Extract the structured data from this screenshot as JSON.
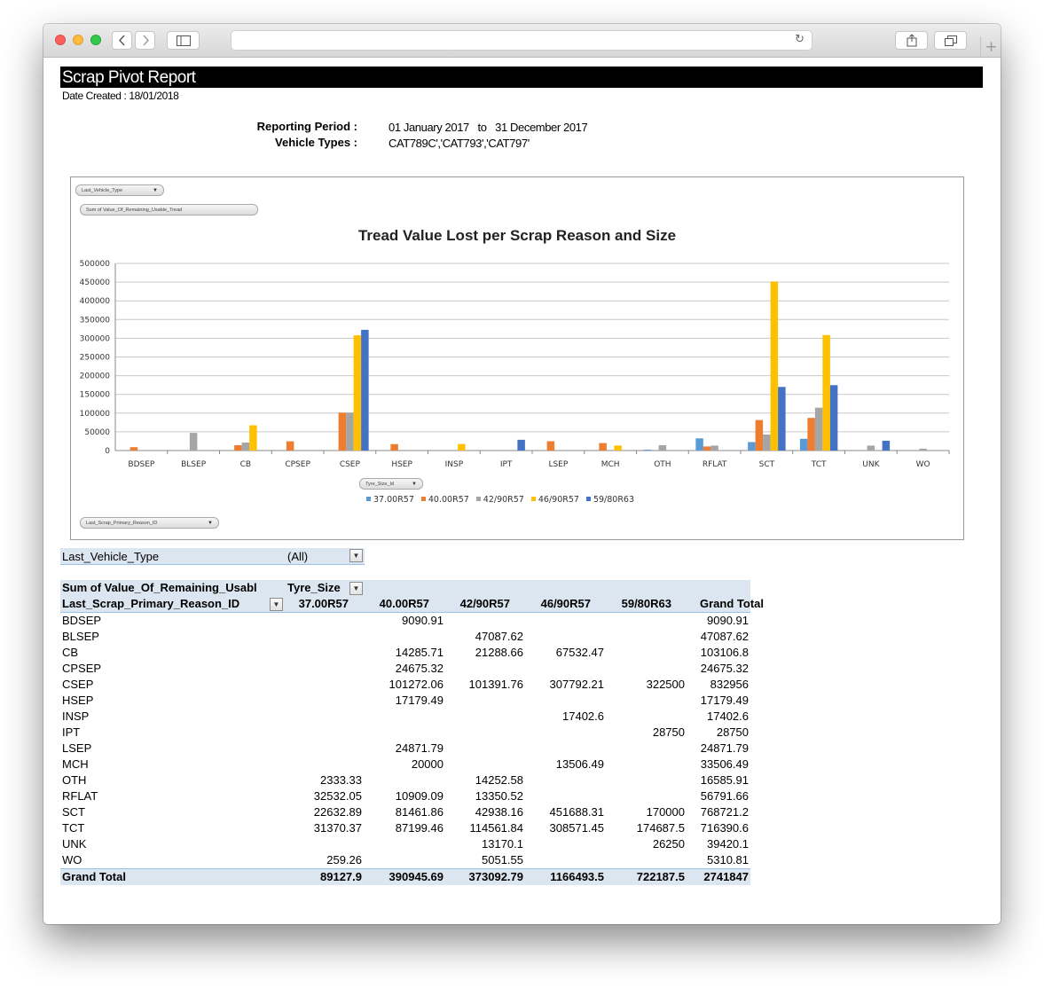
{
  "browser": {
    "back_icon": "chevron-left-icon",
    "forward_icon": "chevron-right-icon",
    "sidebar_icon": "sidebar-icon",
    "reload_icon": "reload-icon",
    "share_icon": "share-icon",
    "tabs_icon": "tabs-icon",
    "new_tab_icon": "plus-icon"
  },
  "report": {
    "title": "Scrap Pivot Report",
    "date_created": "Date Created : 18/01/2018",
    "reporting_period_label": "Reporting Period :",
    "reporting_period_value": "01 January 2017   to   31 December 2017",
    "vehicle_types_label": "Vehicle Types :",
    "vehicle_types_value": "CAT789C','CAT793','CAT797'"
  },
  "chart_ui": {
    "filter_pill": "Last_Vehicle_Type",
    "values_pill": "Sum of Value_Of_Remaining_Usable_Tread",
    "legend_pill": "Tyre_Size_Id",
    "axis_pill": "Last_Scrap_Primary_Reason_ID"
  },
  "chart_data": {
    "type": "bar",
    "title": "Tread Value Lost per Scrap Reason and Size",
    "xlabel": "",
    "ylabel": "",
    "ylim": [
      0,
      500000
    ],
    "yticks": [
      0,
      50000,
      100000,
      150000,
      200000,
      250000,
      300000,
      350000,
      400000,
      450000,
      500000
    ],
    "grid": true,
    "legend_position": "bottom",
    "categories": [
      "BDSEP",
      "BLSEP",
      "CB",
      "CPSEP",
      "CSEP",
      "HSEP",
      "INSP",
      "IPT",
      "LSEP",
      "MCH",
      "OTH",
      "RFLAT",
      "SCT",
      "TCT",
      "UNK",
      "WO"
    ],
    "series": [
      {
        "name": "37.00R57",
        "color": "#5b9bd5",
        "values": [
          0,
          0,
          0,
          0,
          0,
          0,
          0,
          0,
          0,
          0,
          2333.33,
          32532.05,
          22632.89,
          31370.37,
          0,
          259.26
        ]
      },
      {
        "name": "40.00R57",
        "color": "#ed7d31",
        "values": [
          9090.91,
          0,
          14285.71,
          24675.32,
          101272.06,
          17179.49,
          0,
          0,
          24871.79,
          20000,
          0,
          10909.09,
          81461.86,
          87199.46,
          0,
          0
        ]
      },
      {
        "name": "42/90R57",
        "color": "#a5a5a5",
        "values": [
          0,
          47087.62,
          21288.66,
          0,
          101391.76,
          0,
          0,
          0,
          0,
          0,
          14252.58,
          13350.52,
          42938.16,
          114561.84,
          13170.1,
          5051.55
        ]
      },
      {
        "name": "46/90R57",
        "color": "#ffc000",
        "values": [
          0,
          0,
          67532.47,
          0,
          307792.21,
          0,
          17402.6,
          0,
          0,
          13506.49,
          0,
          0,
          451688.31,
          308571.45,
          0,
          0
        ]
      },
      {
        "name": "59/80R63",
        "color": "#4472c4",
        "values": [
          0,
          0,
          0,
          0,
          322500,
          0,
          0,
          28750,
          0,
          0,
          0,
          0,
          170000,
          174687.5,
          26250,
          0
        ]
      }
    ]
  },
  "pivot": {
    "filter_label": "Last_Vehicle_Type",
    "filter_value": "(All)",
    "values_header": "Sum of Value_Of_Remaining_Usabl",
    "columns_header": "Tyre_Size",
    "rows_header": "Last_Scrap_Primary_Reason_ID",
    "column_labels": [
      "37.00R57",
      "40.00R57",
      "42/90R57",
      "46/90R57",
      "59/80R63",
      "Grand Total"
    ],
    "rows": [
      {
        "label": "BDSEP",
        "cells": [
          "",
          "9090.91",
          "",
          "",
          "",
          "9090.91"
        ]
      },
      {
        "label": "BLSEP",
        "cells": [
          "",
          "",
          "47087.62",
          "",
          "",
          "47087.62"
        ]
      },
      {
        "label": "CB",
        "cells": [
          "",
          "14285.71",
          "21288.66",
          "67532.47",
          "",
          "103106.8"
        ]
      },
      {
        "label": "CPSEP",
        "cells": [
          "",
          "24675.32",
          "",
          "",
          "",
          "24675.32"
        ]
      },
      {
        "label": "CSEP",
        "cells": [
          "",
          "101272.06",
          "101391.76",
          "307792.21",
          "322500",
          "832956"
        ]
      },
      {
        "label": "HSEP",
        "cells": [
          "",
          "17179.49",
          "",
          "",
          "",
          "17179.49"
        ]
      },
      {
        "label": "INSP",
        "cells": [
          "",
          "",
          "",
          "17402.6",
          "",
          "17402.6"
        ]
      },
      {
        "label": "IPT",
        "cells": [
          "",
          "",
          "",
          "",
          "28750",
          "28750"
        ]
      },
      {
        "label": "LSEP",
        "cells": [
          "",
          "24871.79",
          "",
          "",
          "",
          "24871.79"
        ]
      },
      {
        "label": "MCH",
        "cells": [
          "",
          "20000",
          "",
          "13506.49",
          "",
          "33506.49"
        ]
      },
      {
        "label": "OTH",
        "cells": [
          "2333.33",
          "",
          "14252.58",
          "",
          "",
          "16585.91"
        ]
      },
      {
        "label": "RFLAT",
        "cells": [
          "32532.05",
          "10909.09",
          "13350.52",
          "",
          "",
          "56791.66"
        ]
      },
      {
        "label": "SCT",
        "cells": [
          "22632.89",
          "81461.86",
          "42938.16",
          "451688.31",
          "170000",
          "768721.2"
        ]
      },
      {
        "label": "TCT",
        "cells": [
          "31370.37",
          "87199.46",
          "114561.84",
          "308571.45",
          "174687.5",
          "716390.6"
        ]
      },
      {
        "label": "UNK",
        "cells": [
          "",
          "",
          "13170.1",
          "",
          "26250",
          "39420.1"
        ]
      },
      {
        "label": "WO",
        "cells": [
          "259.26",
          "",
          "5051.55",
          "",
          "",
          "5310.81"
        ]
      }
    ],
    "grand_total_label": "Grand Total",
    "grand_total": [
      "89127.9",
      "390945.69",
      "373092.79",
      "1166493.5",
      "722187.5",
      "2741847"
    ]
  }
}
